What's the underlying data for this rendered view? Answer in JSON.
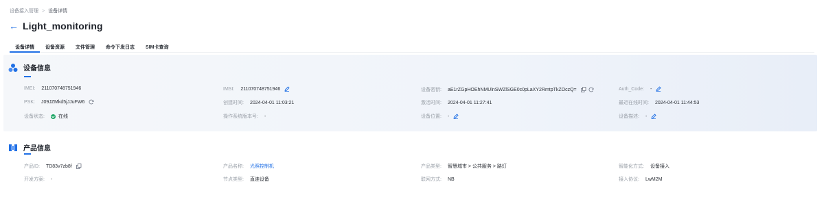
{
  "breadcrumb": {
    "parent": "设备接入管理",
    "separator": ">",
    "current": "设备详情"
  },
  "header": {
    "back_icon": "arrow-left-icon",
    "title": "Light_monitoring"
  },
  "tabs": [
    {
      "label": "设备详情",
      "active": true
    },
    {
      "label": "设备资源",
      "active": false
    },
    {
      "label": "文件管理",
      "active": false
    },
    {
      "label": "命令下发日志",
      "active": false
    },
    {
      "label": "SIM卡查询",
      "active": false
    }
  ],
  "device_info": {
    "title": "设备信息",
    "icon": "device-cluster-icon",
    "imei": {
      "label": "IMEI:",
      "value": "211070748751946"
    },
    "imsi": {
      "label": "IMSI:",
      "value": "211070748751946"
    },
    "device_key": {
      "label": "设备密钥:",
      "value": "aE1rZGpHOEhNMUlnSWZlSGE0c0pLaXY2RmtpTkZOczQ="
    },
    "auth_code": {
      "label": "Auth_Code:",
      "value": "-"
    },
    "psk": {
      "label": "PSK:",
      "value": "J09JZMkd5jJJuFW6"
    },
    "created_time": {
      "label": "创建时间:",
      "value": "2024-04-01 11:03:21"
    },
    "activated_time": {
      "label": "激活时间:",
      "value": "2024-04-01 11:27:41"
    },
    "last_online_time": {
      "label": "最近在线时间:",
      "value": "2024-04-01 11:44:53"
    },
    "status": {
      "label": "设备状态:",
      "value": "在线"
    },
    "os_version": {
      "label": "操作系统版本号:",
      "value": "-"
    },
    "location": {
      "label": "设备位置:",
      "value": "-"
    },
    "description": {
      "label": "设备描述:",
      "value": "-"
    }
  },
  "product_info": {
    "title": "产品信息",
    "icon": "product-box-icon",
    "product_id": {
      "label": "产品ID:",
      "value": "TD83v7zb8f"
    },
    "product_name": {
      "label": "产品名称:",
      "value": "光照控制机"
    },
    "product_type": {
      "label": "产品类型:",
      "value": "智慧城市 > 公共服务 > 路灯"
    },
    "smart_mode": {
      "label": "智能化方式:",
      "value": "设备接入"
    },
    "dev_scheme": {
      "label": "开发方案:",
      "value": "-"
    },
    "node_type": {
      "label": "节点类型:",
      "value": "直连设备"
    },
    "network": {
      "label": "联网方式:",
      "value": "NB"
    },
    "protocol": {
      "label": "接入协议:",
      "value": "LwM2M"
    }
  },
  "colors": {
    "accent": "#1f6fe5",
    "online": "#19a463"
  }
}
